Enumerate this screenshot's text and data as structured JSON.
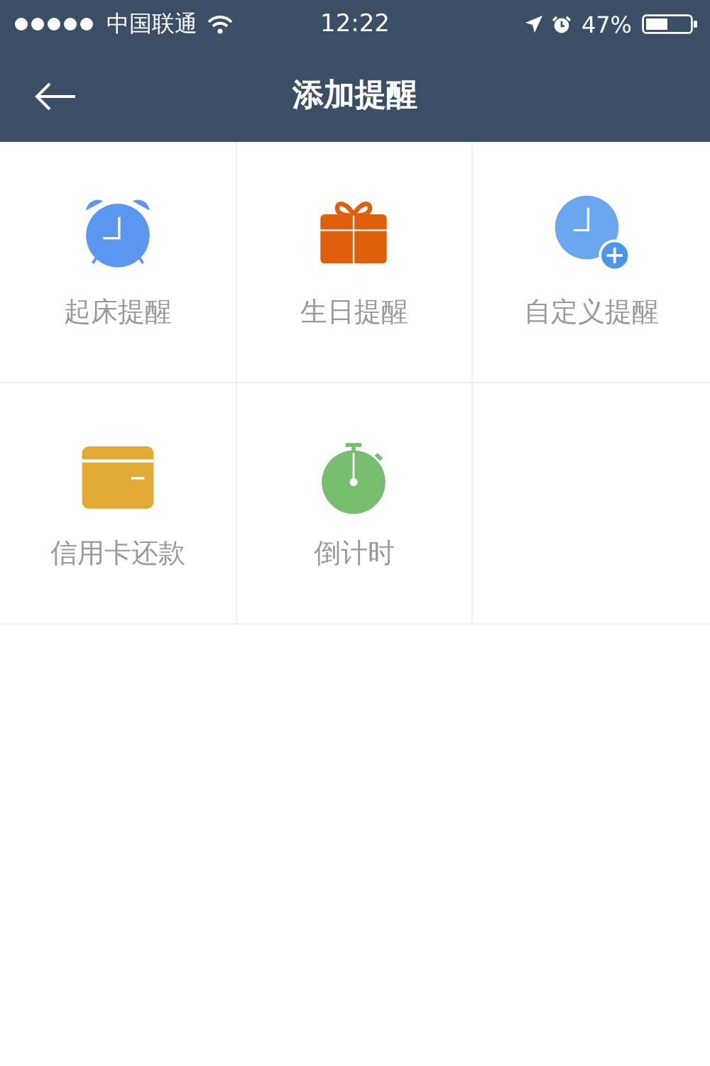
{
  "status_bar": {
    "carrier": "中国联通",
    "time": "12:22",
    "battery": "47%"
  },
  "nav_bar": {
    "title": "添加提醒"
  },
  "tiles": [
    {
      "kind": "alarm",
      "label": "起床提醒"
    },
    {
      "kind": "gift",
      "label": "生日提醒"
    },
    {
      "kind": "custom",
      "label": "自定义提醒"
    },
    {
      "kind": "card",
      "label": "信用卡还款"
    },
    {
      "kind": "timer",
      "label": "倒计时"
    }
  ]
}
